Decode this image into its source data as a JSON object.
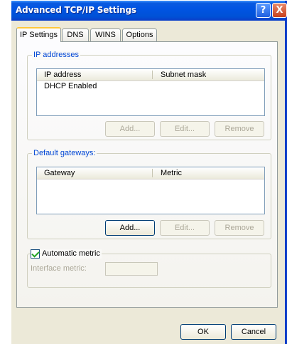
{
  "window": {
    "title": "Advanced TCP/IP Settings",
    "help_glyph": "?",
    "close_glyph": "X"
  },
  "tabs": [
    {
      "label": "IP Settings",
      "active": true
    },
    {
      "label": "DNS",
      "active": false
    },
    {
      "label": "WINS",
      "active": false
    },
    {
      "label": "Options",
      "active": false
    }
  ],
  "ip_addresses": {
    "group_label": "IP addresses",
    "columns": [
      "IP address",
      "Subnet mask"
    ],
    "rows": [
      "DHCP Enabled"
    ],
    "buttons": {
      "add": "Add...",
      "edit": "Edit...",
      "remove": "Remove"
    }
  },
  "default_gateways": {
    "group_label": "Default gateways:",
    "columns": [
      "Gateway",
      "Metric"
    ],
    "buttons": {
      "add": "Add...",
      "edit": "Edit...",
      "remove": "Remove"
    }
  },
  "automatic_metric": {
    "label": "Automatic metric",
    "checked": true,
    "interface_metric_label": "Interface metric:",
    "interface_metric_value": ""
  },
  "footer": {
    "ok": "OK",
    "cancel": "Cancel"
  },
  "colors": {
    "title_bar": "#0054e3",
    "group_label": "#0046d5",
    "dialog_bg": "#ece9d8"
  }
}
